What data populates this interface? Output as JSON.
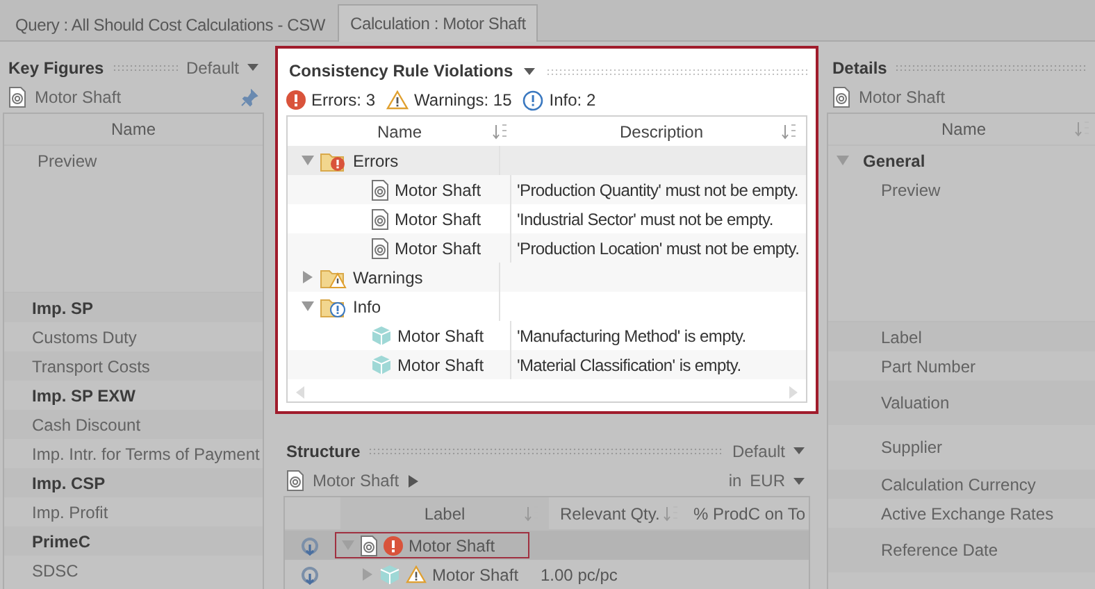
{
  "tabs": [
    {
      "label": "Query : All Should Cost Calculations - CSW",
      "selected": false
    },
    {
      "label": "Calculation : Motor Shaft",
      "selected": true
    }
  ],
  "key_figures": {
    "title": "Key Figures",
    "view": "Default",
    "object": "Motor Shaft",
    "column": "Name",
    "preview": "Preview",
    "rows": [
      {
        "label": "Imp. SP",
        "bold": true
      },
      {
        "label": "Customs Duty",
        "bold": false
      },
      {
        "label": "Transport Costs",
        "bold": false
      },
      {
        "label": "Imp. SP EXW",
        "bold": true
      },
      {
        "label": "Cash Discount",
        "bold": false
      },
      {
        "label": "Imp. Intr. for Terms of Payment",
        "bold": false
      },
      {
        "label": "Imp. CSP",
        "bold": true
      },
      {
        "label": "Imp. Profit",
        "bold": false
      },
      {
        "label": "PrimeC",
        "bold": true
      },
      {
        "label": "SDSC",
        "bold": false
      }
    ]
  },
  "violations": {
    "title": "Consistency Rule Violations",
    "counts": [
      {
        "kind": "error",
        "label": "Errors: 3"
      },
      {
        "kind": "warning",
        "label": "Warnings: 15"
      },
      {
        "kind": "info",
        "label": "Info: 2"
      }
    ],
    "columns": [
      "Name",
      "Description"
    ],
    "groups": [
      {
        "label": "Errors",
        "kind": "error",
        "expanded": true,
        "children": [
          {
            "name": "Motor Shaft",
            "kind": "part",
            "description": "'Production Quantity' must not be empty."
          },
          {
            "name": "Motor Shaft",
            "kind": "part",
            "description": "'Industrial Sector' must not be empty."
          },
          {
            "name": "Motor Shaft",
            "kind": "part",
            "description": "'Production Location' must not be empty."
          }
        ]
      },
      {
        "label": "Warnings",
        "kind": "warning",
        "expanded": false
      },
      {
        "label": "Info",
        "kind": "info",
        "expanded": true,
        "children": [
          {
            "name": "Motor Shaft",
            "kind": "material",
            "description": "'Manufacturing Method' is empty."
          },
          {
            "name": "Motor Shaft",
            "kind": "material",
            "description": "'Material Classification' is empty."
          }
        ]
      }
    ]
  },
  "structure": {
    "title": "Structure",
    "view": "Default",
    "object": "Motor Shaft",
    "currency_prefix": "in",
    "currency": "EUR",
    "columns": [
      "Label",
      "Relevant Qty.",
      "% ProdC on To"
    ],
    "rows": [
      {
        "label": "Motor Shaft",
        "kind": "part",
        "has_error": true,
        "has_warning": false,
        "expanded": true,
        "selected": true,
        "children": [
          {
            "label": "Motor Shaft",
            "kind": "material",
            "has_error": false,
            "has_warning": true,
            "expanded": false,
            "selected": false,
            "qty": "1.00 pc/pc"
          }
        ]
      }
    ]
  },
  "details": {
    "title": "Details",
    "object": "Motor Shaft",
    "column": "Name",
    "groups": [
      {
        "label": "General",
        "expanded": true,
        "children": [
          {
            "label": "Preview",
            "kind": "preview"
          },
          {
            "label": "Label",
            "kind": "field"
          },
          {
            "label": "Part Number",
            "kind": "field"
          },
          {
            "label": "Valuation",
            "kind": "tall"
          },
          {
            "label": "Supplier",
            "kind": "tall"
          },
          {
            "label": "Calculation Currency",
            "kind": "field"
          },
          {
            "label": "Active Exchange Rates",
            "kind": "field"
          },
          {
            "label": "Reference Date",
            "kind": "tall"
          }
        ]
      }
    ]
  }
}
